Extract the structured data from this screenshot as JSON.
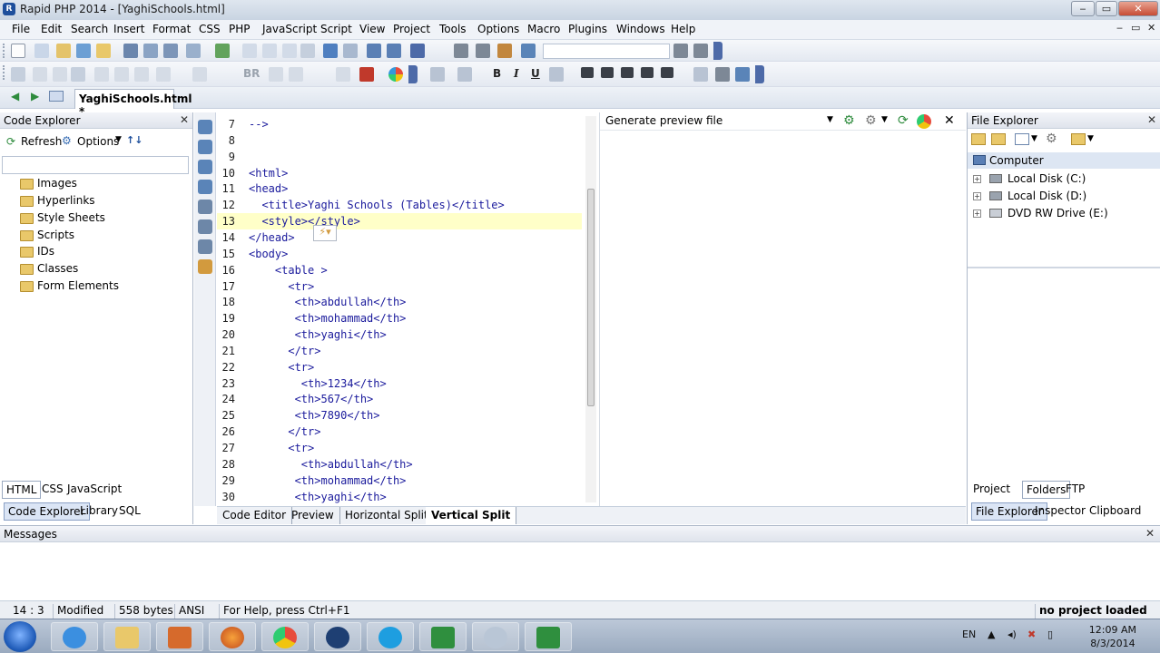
{
  "window": {
    "title": "Rapid PHP 2014 - [YaghiSchools.html]",
    "min": "‒",
    "restore": "▭",
    "close": "✕"
  },
  "menu": [
    "File",
    "Edit",
    "Search",
    "Insert",
    "Format",
    "CSS",
    "PHP",
    "JavaScript",
    "Script",
    "View",
    "Project",
    "Tools",
    "Options",
    "Macro",
    "Plugins",
    "Windows",
    "Help"
  ],
  "toolbar": {
    "bold": "B",
    "italic": "I",
    "underline": "U",
    "br": "BR"
  },
  "file_tab": "YaghiSchools.html *",
  "code_explorer": {
    "title": "Code Explorer",
    "refresh": "Refresh",
    "options": "Options",
    "items": [
      "Images",
      "Hyperlinks",
      "Style Sheets",
      "Scripts",
      "IDs",
      "Classes",
      "Form Elements"
    ],
    "lang_tabs": [
      "HTML",
      "CSS",
      "JavaScript"
    ],
    "panel_tabs": [
      "Code Explorer",
      "Library",
      "SQL"
    ]
  },
  "editor": {
    "lines": [
      {
        "n": "7",
        "t": "-->"
      },
      {
        "n": "8",
        "t": ""
      },
      {
        "n": "9",
        "t": ""
      },
      {
        "n": "10",
        "t": "<html>"
      },
      {
        "n": "11",
        "t": "<head>"
      },
      {
        "n": "12",
        "t": "  <title>Yaghi Schools (Tables)</title>"
      },
      {
        "n": "13",
        "t": "  <style></style>"
      },
      {
        "n": "14",
        "t": "</head>"
      },
      {
        "n": "15",
        "t": "<body>"
      },
      {
        "n": "16",
        "t": "    <table >"
      },
      {
        "n": "17",
        "t": "      <tr>"
      },
      {
        "n": "18",
        "t": "       <th>abdullah</th>"
      },
      {
        "n": "19",
        "t": "       <th>mohammad</th>"
      },
      {
        "n": "20",
        "t": "       <th>yaghi</th>"
      },
      {
        "n": "21",
        "t": "      </tr>"
      },
      {
        "n": "22",
        "t": "      <tr>"
      },
      {
        "n": "23",
        "t": "        <th>1234</th>"
      },
      {
        "n": "24",
        "t": "       <th>567</th>"
      },
      {
        "n": "25",
        "t": "       <th>7890</th>"
      },
      {
        "n": "26",
        "t": "      </tr>"
      },
      {
        "n": "27",
        "t": "      <tr>"
      },
      {
        "n": "28",
        "t": "        <th>abdullah</th>"
      },
      {
        "n": "29",
        "t": "       <th>mohammad</th>"
      },
      {
        "n": "30",
        "t": "       <th>yaghi</th>"
      }
    ],
    "current_line": "13",
    "view_tabs": [
      "Code Editor",
      "Preview",
      "Horizontal Split",
      "Vertical Split"
    ],
    "active_view": "Vertical Split"
  },
  "preview": {
    "combo": "Generate preview file"
  },
  "file_explorer": {
    "title": "File Explorer",
    "root": "Computer",
    "drives": [
      "Local Disk (C:)",
      "Local Disk (D:)",
      "DVD RW Drive (E:)"
    ],
    "top_tabs": [
      "Project",
      "Folders",
      "FTP"
    ],
    "panel_tabs": [
      "File Explorer",
      "Inspector",
      "Clipboard"
    ]
  },
  "messages": {
    "title": "Messages"
  },
  "status": {
    "pos": "14 : 3",
    "state": "Modified",
    "size": "558 bytes",
    "enc": "ANSI",
    "help": "For Help, press Ctrl+F1",
    "project": "no project loaded"
  },
  "taskbar": {
    "lang": "EN",
    "time": "12:09 AM",
    "date": "8/3/2014"
  }
}
